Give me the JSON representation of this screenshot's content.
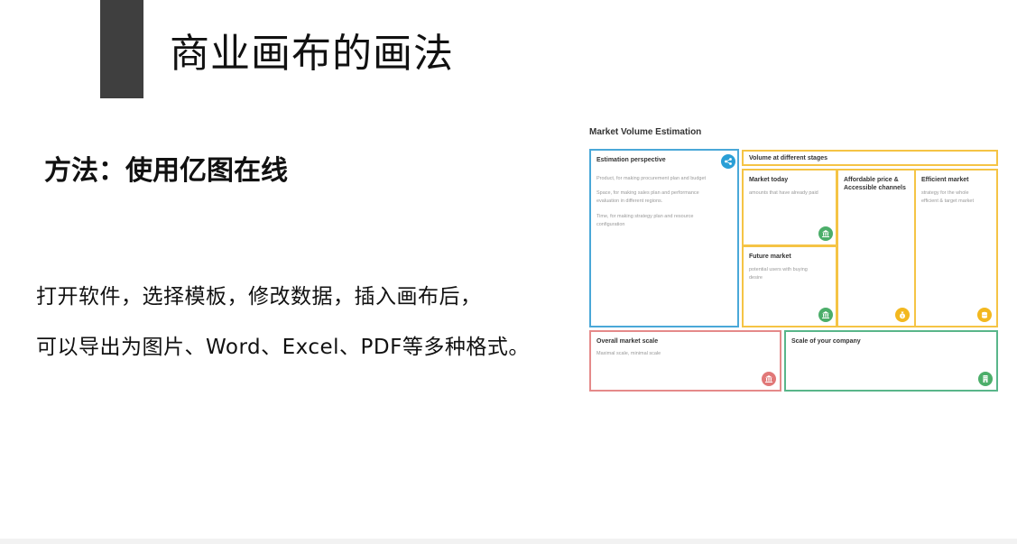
{
  "page": {
    "title": "商业画布的画法",
    "subtitle": "方法：使用亿图在线",
    "body_lines": [
      "打开软件，选择模板，修改数据，插入画布后，",
      "可以导出为图片、Word、Excel、PDF等多种格式。"
    ]
  },
  "canvas": {
    "title": "Market Volume Estimation",
    "estimation": {
      "heading": "Estimation perspective",
      "lines": [
        "Product, for making procurement plan and budget",
        "Space, for making sales plan and performance",
        "evaluation in different regions.",
        "Time, for making strategy plan and resource",
        "configuration"
      ],
      "icon": "share-icon"
    },
    "stages": {
      "heading": "Volume at different stages"
    },
    "market_today": {
      "heading": "Market today",
      "text": "amounts that have already paid",
      "icon": "bank-icon"
    },
    "future_market": {
      "heading": "Future market",
      "lines": [
        "potential users with buying",
        "desire"
      ],
      "icon": "bank-icon"
    },
    "affordable": {
      "heading_lines": [
        "Affordable price &",
        "Accessible channels"
      ],
      "icon": "money-bag-icon"
    },
    "efficient": {
      "heading": "Efficient market",
      "lines": [
        "strategy for the whole",
        "efficient & target market"
      ],
      "icon": "coins-icon"
    },
    "overall": {
      "heading": "Overall market scale",
      "text": "Maximal scale,   minimal scale",
      "icon": "bank-icon"
    },
    "company": {
      "heading": "Scale of your company",
      "icon": "building-icon"
    }
  },
  "colors": {
    "accent_bar": "#3f3f3f",
    "blue": "#4aa8d8",
    "yellow": "#f5c445",
    "red": "#e58a8a",
    "green": "#59b68a"
  }
}
